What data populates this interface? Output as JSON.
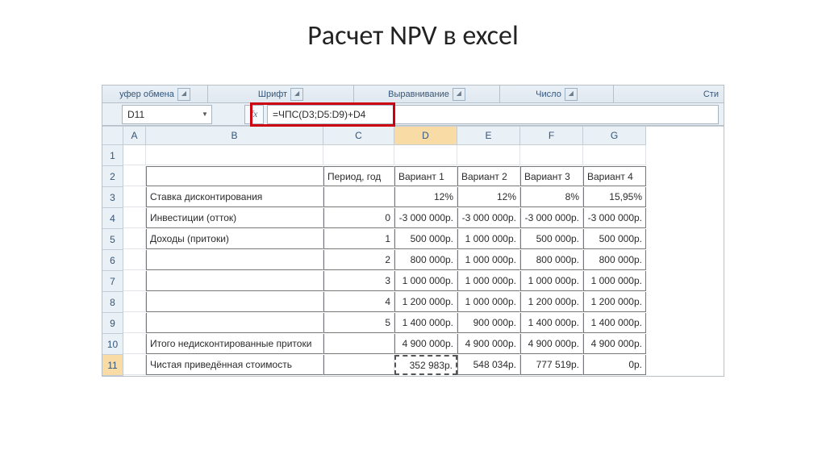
{
  "page_title": "Расчет NPV в excel",
  "ribbon_groups": [
    "уфер обмена",
    "Шрифт",
    "Выравнивание",
    "Число",
    "Сти"
  ],
  "formula_bar": {
    "cell_ref": "D11",
    "fx_label": "fx",
    "formula": "=ЧПС(D3;D5:D9)+D4"
  },
  "columns": [
    "A",
    "B",
    "C",
    "D",
    "E",
    "F",
    "G"
  ],
  "row_numbers": [
    "1",
    "2",
    "3",
    "4",
    "5",
    "6",
    "7",
    "8",
    "9",
    "10",
    "11"
  ],
  "active_col_idx": 3,
  "active_row_idx": 10,
  "table": {
    "headers": {
      "period": "Период, год",
      "v1": "Вариант 1",
      "v2": "Вариант 2",
      "v3": "Вариант 3",
      "v4": "Вариант 4"
    },
    "rows": [
      {
        "label": "Ставка дисконтирования",
        "period": "",
        "v1": "12%",
        "v2": "12%",
        "v3": "8%",
        "v4": "15,95%"
      },
      {
        "label": "Инвестиции (отток)",
        "period": "0",
        "v1": "-3 000 000р.",
        "v2": "-3 000 000р.",
        "v3": "-3 000 000р.",
        "v4": "-3 000 000р."
      },
      {
        "label": "Доходы (притоки)",
        "period": "1",
        "v1": "500 000р.",
        "v2": "1 000 000р.",
        "v3": "500 000р.",
        "v4": "500 000р."
      },
      {
        "label": "",
        "period": "2",
        "v1": "800 000р.",
        "v2": "1 000 000р.",
        "v3": "800 000р.",
        "v4": "800 000р."
      },
      {
        "label": "",
        "period": "3",
        "v1": "1 000 000р.",
        "v2": "1 000 000р.",
        "v3": "1 000 000р.",
        "v4": "1 000 000р."
      },
      {
        "label": "",
        "period": "4",
        "v1": "1 200 000р.",
        "v2": "1 000 000р.",
        "v3": "1 200 000р.",
        "v4": "1 200 000р."
      },
      {
        "label": "",
        "period": "5",
        "v1": "1 400 000р.",
        "v2": "900 000р.",
        "v3": "1 400 000р.",
        "v4": "1 400 000р."
      },
      {
        "label": "Итого недисконтированные притоки",
        "period": "",
        "v1": "4 900 000р.",
        "v2": "4 900 000р.",
        "v3": "4 900 000р.",
        "v4": "4 900 000р."
      },
      {
        "label": "Чистая приведённая стоимость",
        "period": "",
        "v1": "352 983р.",
        "v2": "548 034р.",
        "v3": "777 519р.",
        "v4": "0р."
      }
    ]
  },
  "chart_data": {
    "type": "table",
    "title": "Расчет NPV в excel",
    "columns": [
      "Период, год",
      "Вариант 1",
      "Вариант 2",
      "Вариант 3",
      "Вариант 4"
    ],
    "row_labels": [
      "Ставка дисконтирования",
      "Инвестиции (отток)",
      "Доходы (притоки) 1",
      "Доходы (притоки) 2",
      "Доходы (притоки) 3",
      "Доходы (притоки) 4",
      "Доходы (притоки) 5",
      "Итого недисконтированные притоки",
      "Чистая приведённая стоимость"
    ],
    "series": [
      {
        "name": "Вариант 1",
        "discount_rate": 0.12,
        "investment": -3000000,
        "inflows": [
          500000,
          800000,
          1000000,
          1200000,
          1400000
        ],
        "total_inflows": 4900000,
        "npv": 352983
      },
      {
        "name": "Вариант 2",
        "discount_rate": 0.12,
        "investment": -3000000,
        "inflows": [
          1000000,
          1000000,
          1000000,
          1000000,
          900000
        ],
        "total_inflows": 4900000,
        "npv": 548034
      },
      {
        "name": "Вариант 3",
        "discount_rate": 0.08,
        "investment": -3000000,
        "inflows": [
          500000,
          800000,
          1000000,
          1200000,
          1400000
        ],
        "total_inflows": 4900000,
        "npv": 777519
      },
      {
        "name": "Вариант 4",
        "discount_rate": 0.1595,
        "investment": -3000000,
        "inflows": [
          500000,
          800000,
          1000000,
          1200000,
          1400000
        ],
        "total_inflows": 4900000,
        "npv": 0
      }
    ]
  }
}
